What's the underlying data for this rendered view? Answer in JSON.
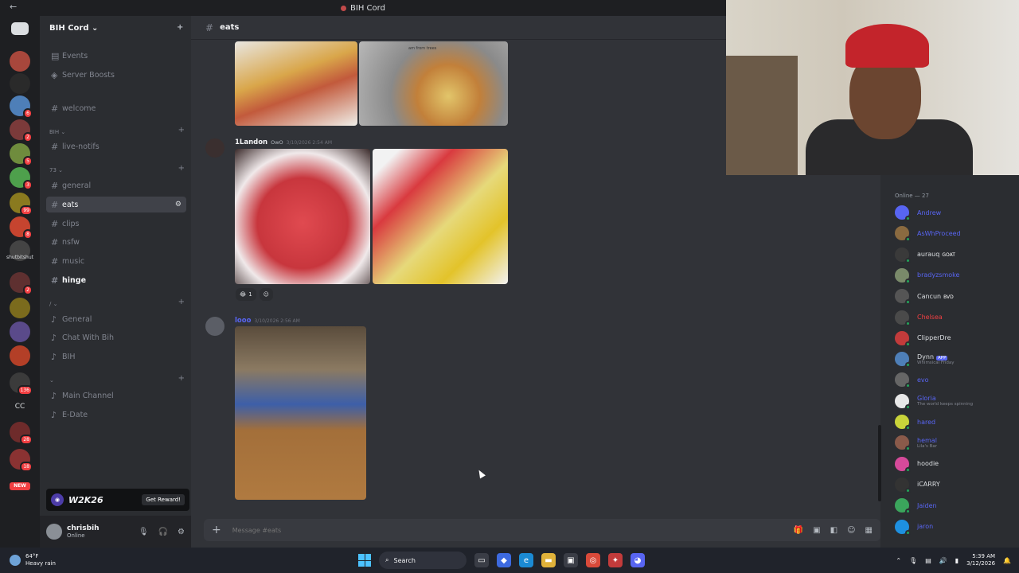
{
  "window": {
    "title": "BIH Cord"
  },
  "server": {
    "name": "BIH Cord ⌄"
  },
  "guild_badges": [
    "6",
    "2",
    "5",
    "3",
    "99",
    "8",
    "2",
    "136",
    "28",
    "18"
  ],
  "guild_labels": {
    "text_guild": "shutbitshut",
    "cc": "CC",
    "new": "NEW"
  },
  "sidebar": {
    "top_items": [
      {
        "label": "Events"
      },
      {
        "label": "Server Boosts"
      }
    ],
    "channels": {
      "welcome": "welcome",
      "cat_bih": "BIH ⌄",
      "live_notifs": "live-notifs",
      "cat_73": "73 ⌄",
      "general": "general",
      "eats": "eats",
      "clips": "clips",
      "nsfw": "nsfw",
      "music": "music",
      "hinge": "hinge",
      "cat_voice1": "/ ⌄",
      "voice_general": "General",
      "chat_with_bih": "Chat With Bih",
      "bih": "BIH",
      "cat_voice2": "⌄",
      "main_channel": "Main Channel",
      "e_date": "E-Date"
    }
  },
  "promo": {
    "game": "W2K26",
    "cta": "Get Reward!"
  },
  "user": {
    "name": "chrisbih",
    "status": "Online"
  },
  "chat": {
    "channel": "eats",
    "messages": [
      {
        "author": "1Landon",
        "tag": "OwO",
        "time": "3/10/2026 2:54 AM"
      },
      {
        "author": "looo",
        "time": "3/10/2026 2:56 AM"
      }
    ],
    "reactions": [
      {
        "emoji": "😂",
        "count": "1"
      }
    ],
    "image_text": "am from trees",
    "composer_placeholder": "Message #eats"
  },
  "members": {
    "heading": "Online — 27",
    "list": [
      {
        "name": "Andrew",
        "color": "#5865f2"
      },
      {
        "name": "AsWhProceed",
        "color": "#5865f2"
      },
      {
        "name": "aurauq",
        "badge": "GOAT",
        "color": "#dbdee1"
      },
      {
        "name": "bradyzsmoke",
        "color": "#5865f2"
      },
      {
        "name": "Cancun",
        "badge": "BVD",
        "color": "#dbdee1"
      },
      {
        "name": "Chelsea",
        "color": "#f23f42"
      },
      {
        "name": "ClipperDre",
        "color": "#dbdee1"
      },
      {
        "name": "Dynn",
        "badge": "APP",
        "sub": "Whimsical Friday",
        "color": "#dbdee1"
      },
      {
        "name": "evo",
        "color": "#5865f2"
      },
      {
        "name": "Gloria",
        "sub": "The world keeps spinning",
        "color": "#5865f2"
      },
      {
        "name": "hared",
        "color": "#5865f2"
      },
      {
        "name": "hemal",
        "sub": "Lila's Bar",
        "color": "#5865f2"
      },
      {
        "name": "hoodie",
        "color": "#dbdee1"
      },
      {
        "name": "iCARRY",
        "color": "#dbdee1"
      },
      {
        "name": "Jaiden",
        "color": "#5865f2"
      },
      {
        "name": "jaron",
        "color": "#5865f2"
      }
    ]
  },
  "taskbar": {
    "weather_temp": "64°F",
    "weather_desc": "Heavy rain",
    "search": "Search",
    "time": "5:39 AM",
    "date": "3/12/2026"
  },
  "colors": {
    "accent": "#5865f2",
    "danger": "#f23f42",
    "online": "#23a55a"
  }
}
